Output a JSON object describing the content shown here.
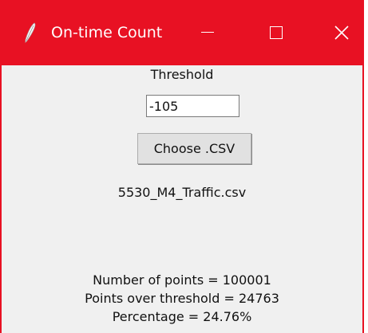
{
  "window": {
    "title": "On-time Count",
    "accent_color": "#e81123",
    "icons": {
      "app": "feather-icon",
      "minimize": "minimize-icon",
      "maximize": "maximize-icon",
      "close": "close-icon"
    }
  },
  "form": {
    "threshold_label": "Threshold",
    "threshold_value": "-105",
    "choose_button_label": "Choose .CSV",
    "selected_file": "5530_M4_Traffic.csv"
  },
  "results": {
    "points_line": "Number of points = 100001",
    "over_threshold_line": "Points over threshold = 24763",
    "percentage_line": "Percentage = 24.76%"
  }
}
